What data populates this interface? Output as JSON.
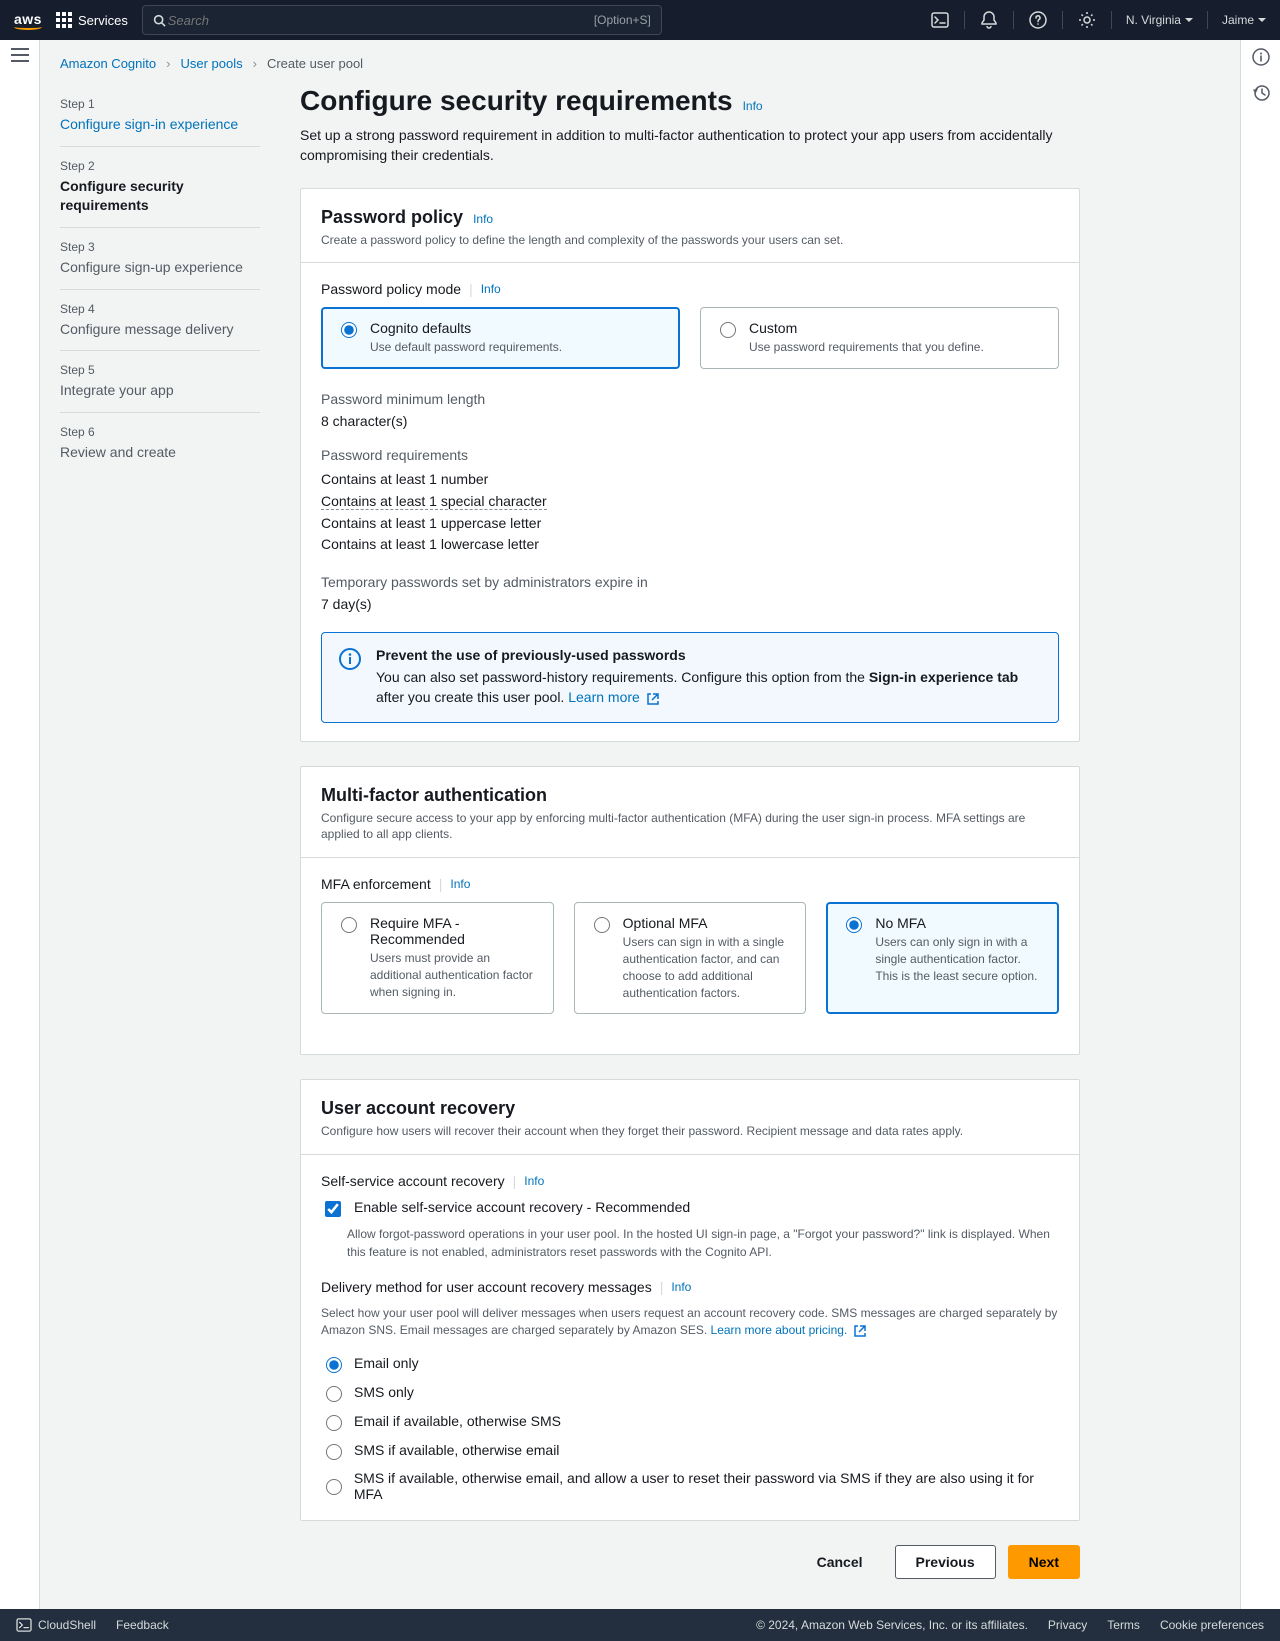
{
  "topnav": {
    "services": "Services",
    "search_placeholder": "Search",
    "shortcut": "[Option+S]",
    "region": "N. Virginia",
    "user": "Jaime"
  },
  "breadcrumbs": {
    "a": "Amazon Cognito",
    "b": "User pools",
    "c": "Create user pool"
  },
  "steps": [
    {
      "label": "Step 1",
      "title": "Configure sign-in experience",
      "link": true
    },
    {
      "label": "Step 2",
      "title": "Configure security requirements",
      "active": true
    },
    {
      "label": "Step 3",
      "title": "Configure sign-up experience"
    },
    {
      "label": "Step 4",
      "title": "Configure message delivery"
    },
    {
      "label": "Step 5",
      "title": "Integrate your app"
    },
    {
      "label": "Step 6",
      "title": "Review and create"
    }
  ],
  "page": {
    "title": "Configure security requirements",
    "info": "Info",
    "desc": "Set up a strong password requirement in addition to multi-factor authentication to protect your app users from accidentally compromising their credentials."
  },
  "password_policy": {
    "title": "Password policy",
    "sub": "Create a password policy to define the length and complexity of the passwords your users can set.",
    "mode_label": "Password policy mode",
    "info": "Info",
    "opt_default_title": "Cognito defaults",
    "opt_default_desc": "Use default password requirements.",
    "opt_custom_title": "Custom",
    "opt_custom_desc": "Use password requirements that you define.",
    "minlen_label": "Password minimum length",
    "minlen_val": "8 character(s)",
    "req_label": "Password requirements",
    "req1": "Contains at least 1 number",
    "req2": "Contains at least 1 special character",
    "req3": "Contains at least 1 uppercase letter",
    "req4": "Contains at least 1 lowercase letter",
    "temp_label": "Temporary passwords set by administrators expire in",
    "temp_val": "7 day(s)",
    "alert_title": "Prevent the use of previously-used passwords",
    "alert_body_a": "You can also set password-history requirements. Configure this option from the ",
    "alert_body_bold": "Sign-in experience tab",
    "alert_body_b": " after you create this user pool. ",
    "alert_link": "Learn more"
  },
  "mfa": {
    "title": "Multi-factor authentication",
    "sub": "Configure secure access to your app by enforcing multi-factor authentication (MFA) during the user sign-in process. MFA settings are applied to all app clients.",
    "enf_label": "MFA enforcement",
    "info": "Info",
    "o1t": "Require MFA - Recommended",
    "o1d": "Users must provide an additional authentication factor when signing in.",
    "o2t": "Optional MFA",
    "o2d": "Users can sign in with a single authentication factor, and can choose to add additional authentication factors.",
    "o3t": "No MFA",
    "o3d": "Users can only sign in with a single authentication factor. This is the least secure option."
  },
  "recovery": {
    "title": "User account recovery",
    "sub": "Configure how users will recover their account when they forget their password. Recipient message and data rates apply.",
    "ss_label": "Self-service account recovery",
    "info": "Info",
    "chk_label": "Enable self-service account recovery - Recommended",
    "chk_desc": "Allow forgot-password operations in your user pool. In the hosted UI sign-in page, a \"Forgot your password?\" link is displayed. When this feature is not enabled, administrators reset passwords with the Cognito API.",
    "dm_label": "Delivery method for user account recovery messages",
    "dm_info": "Info",
    "dm_desc_a": "Select how your user pool will deliver messages when users request an account recovery code. SMS messages are charged separately by Amazon SNS. Email messages are charged separately by Amazon SES. ",
    "dm_link": "Learn more about pricing.",
    "r1": "Email only",
    "r2": "SMS only",
    "r3": "Email if available, otherwise SMS",
    "r4": "SMS if available, otherwise email",
    "r5": "SMS if available, otherwise email, and allow a user to reset their password via SMS if they are also using it for MFA"
  },
  "buttons": {
    "cancel": "Cancel",
    "prev": "Previous",
    "next": "Next"
  },
  "footer": {
    "cloudshell": "CloudShell",
    "feedback": "Feedback",
    "copyright": "© 2024, Amazon Web Services, Inc. or its affiliates.",
    "privacy": "Privacy",
    "terms": "Terms",
    "cookie": "Cookie preferences"
  }
}
